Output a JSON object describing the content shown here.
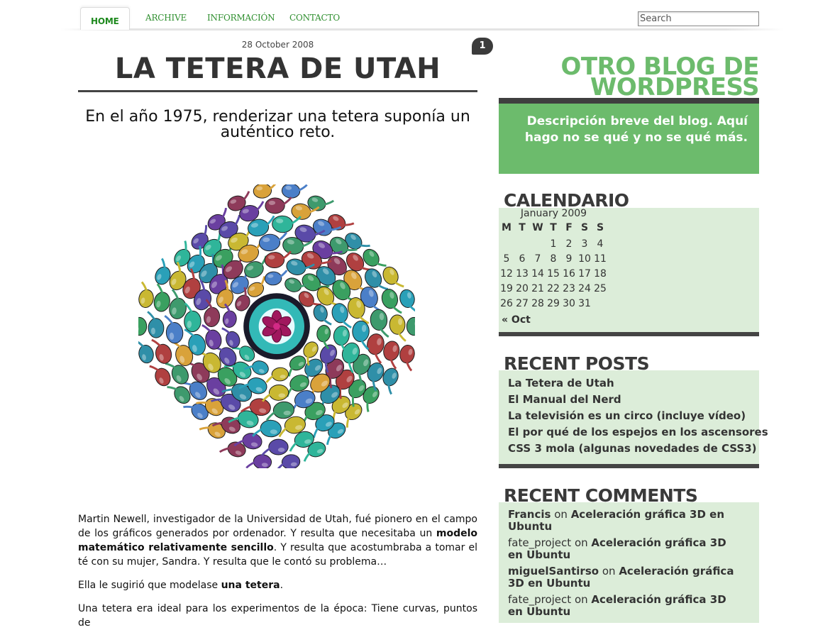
{
  "nav": {
    "tabs": [
      {
        "label": "HOME",
        "active": true
      },
      {
        "label": "ARCHIVE"
      },
      {
        "label": "INFORMACIÓN"
      },
      {
        "label": "CONTACTO"
      }
    ],
    "search_placeholder": "Search"
  },
  "post": {
    "date": "28 October 2008",
    "comment_count": "1",
    "title": "LA TETERA DE UTAH",
    "subtitle": "En el año 1975, renderizar una tetera suponía un auténtico reto.",
    "image_icon": "teapot-kaleidoscope-icon",
    "paragraph1": {
      "t1": "Martin Newell, investigador de la Universidad de Utah, fué pionero en el campo de los gráficos generados por ordenador. Y resulta que necesitaba un ",
      "b1": "modelo matemático relativamente sencillo",
      "t2": ". Y resulta que acostumbraba a tomar el té con su mujer, Sandra. Y resulta que le contó su problema…"
    },
    "paragraph2": {
      "t1": "Ella le sugirió que modelase ",
      "b1": "una tetera",
      "t2": "."
    },
    "paragraph3": "Una tetera era ideal para los experimentos de la época: Tiene curvas, puntos de"
  },
  "sidebar": {
    "blog_name": "OTRO BLOG DE WORDPRESS",
    "description": "Descripción breve del blog. Aquí hago no se qué y no se qué más.",
    "calendar": {
      "title": "CALENDARIO",
      "caption": "January 2009",
      "weekdays": [
        "M",
        "T",
        "W",
        "T",
        "F",
        "S",
        "S"
      ],
      "weeks": [
        [
          "",
          "",
          "",
          "1",
          "2",
          "3",
          "4"
        ],
        [
          "5",
          "6",
          "7",
          "8",
          "9",
          "10",
          "11"
        ],
        [
          "12",
          "13",
          "14",
          "15",
          "16",
          "17",
          "18"
        ],
        [
          "19",
          "20",
          "21",
          "22",
          "23",
          "24",
          "25"
        ],
        [
          "26",
          "27",
          "28",
          "29",
          "30",
          "31",
          ""
        ]
      ],
      "prev_link": "« Oct"
    },
    "recent_posts": {
      "title": "RECENT POSTS",
      "items": [
        "La Tetera de Utah",
        "El Manual del Nerd",
        "La televisión es un circo (incluye vídeo)",
        "El por qué de los espejos en los ascensores",
        "CSS 3 mola (algunas novedades de CSS3)"
      ]
    },
    "recent_comments": {
      "title": "RECENT COMMENTS",
      "items": [
        {
          "author": "Francis",
          "author_bold": true,
          "on": "on",
          "post": "Aceleración gráfica 3D en Ubuntu"
        },
        {
          "author": "fate_project",
          "author_bold": false,
          "on": "on",
          "post": "Aceleración gráfica 3D en Ubuntu"
        },
        {
          "author": "miguelSantirso",
          "author_bold": true,
          "on": "on",
          "post": "Aceleración gráfica 3D en Ubuntu"
        },
        {
          "author": "fate_project",
          "author_bold": false,
          "on": "on",
          "post": "Aceleración gráfica 3D en Ubuntu"
        }
      ]
    }
  },
  "colors": {
    "accent_green": "#6cbb6c",
    "nav_green": "#2f8f2f",
    "widget_bg": "#dcedd9",
    "dark_bar": "#444444"
  }
}
